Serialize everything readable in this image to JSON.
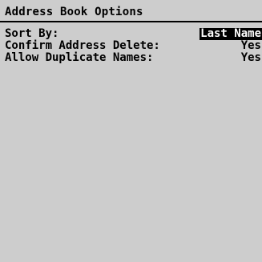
{
  "screen": {
    "title": "Address Book Options"
  },
  "options": [
    {
      "label": "Sort By:",
      "value": "Last Name",
      "selected": true
    },
    {
      "label": "Confirm Address Delete:",
      "value": "Yes",
      "selected": false
    },
    {
      "label": "Allow Duplicate Names:",
      "value": "Yes",
      "selected": false
    }
  ],
  "colors": {
    "background": "#cdcdcd",
    "text": "#000000",
    "selection_background": "#000000",
    "selection_text": "#ffffff"
  }
}
